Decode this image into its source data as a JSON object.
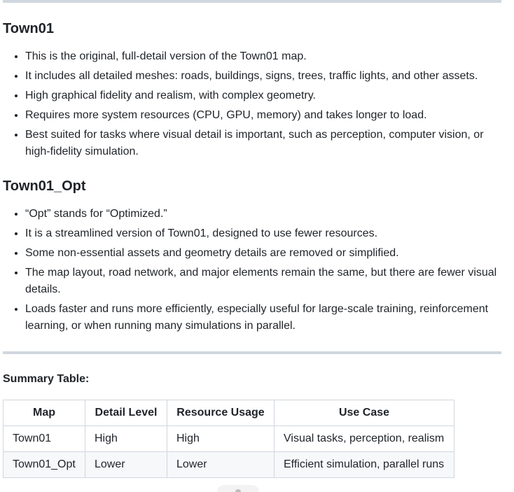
{
  "sections": [
    {
      "heading": "Town01",
      "items": [
        "This is the original, full-detail version of the Town01 map.",
        "It includes all detailed meshes: roads, buildings, signs, trees, traffic lights, and other assets.",
        "High graphical fidelity and realism, with complex geometry.",
        "Requires more system resources (CPU, GPU, memory) and takes longer to load.",
        "Best suited for tasks where visual detail is important, such as perception, computer vision, or high-fidelity simulation."
      ]
    },
    {
      "heading": "Town01_Opt",
      "items": [
        "“Opt” stands for “Optimized.”",
        "It is a streamlined version of Town01, designed to use fewer resources.",
        "Some non-essential assets and geometry details are removed or simplified.",
        "The map layout, road network, and major elements remain the same, but there are fewer visual details.",
        "Loads faster and runs more efficiently, especially useful for large-scale training, reinforcement learning, or when running many simulations in parallel."
      ]
    }
  ],
  "summary": {
    "title": "Summary Table:",
    "headers": [
      "Map",
      "Detail Level",
      "Resource Usage",
      "Use Case"
    ],
    "rows": [
      [
        "Town01",
        "High",
        "High",
        "Visual tasks, perception, realism"
      ],
      [
        "Town01_Opt",
        "Lower",
        "Lower",
        "Efficient simulation, parallel runs"
      ]
    ]
  }
}
